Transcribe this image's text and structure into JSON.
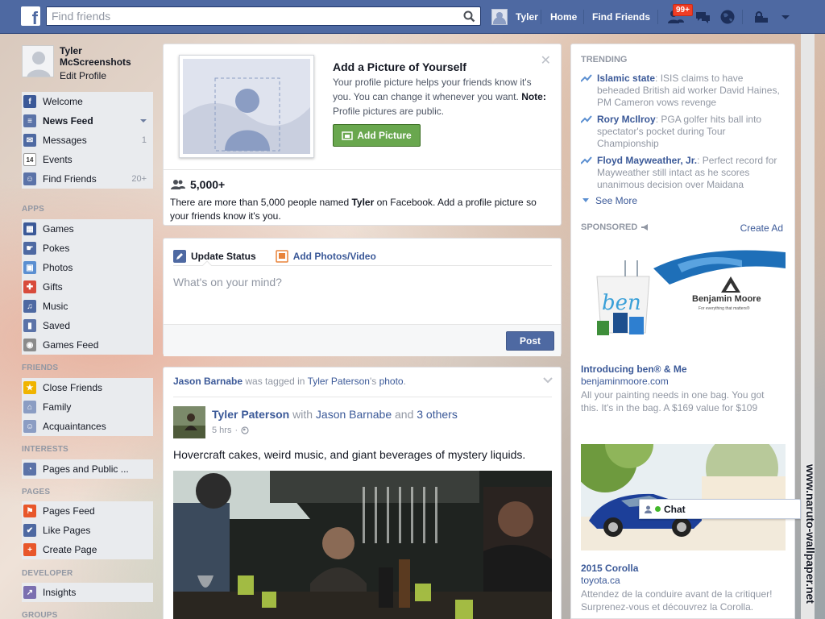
{
  "topbar": {
    "logo": "f",
    "search_placeholder": "Find friends",
    "user_name": "Tyler",
    "home": "Home",
    "find_friends": "Find Friends",
    "notif_badge": "99+"
  },
  "profile": {
    "name": "Tyler McScreenshots",
    "edit": "Edit Profile"
  },
  "nav": {
    "main": [
      {
        "label": "Welcome",
        "icon": "facebook-icon",
        "color": "#3b5998"
      },
      {
        "label": "News Feed",
        "icon": "news-feed-icon",
        "color": "#5b73a8"
      },
      {
        "label": "Messages",
        "icon": "messages-icon",
        "color": "#4e69a2",
        "count": "1"
      },
      {
        "label": "Events",
        "icon": "calendar-icon",
        "color": "#ffffff",
        "count_text": "14"
      },
      {
        "label": "Find Friends",
        "icon": "find-friends-icon",
        "color": "#5b73a8",
        "count": "20+"
      }
    ],
    "apps_head": "APPS",
    "apps": [
      {
        "label": "Games",
        "icon": "games-icon",
        "color": "#3b5998"
      },
      {
        "label": "Pokes",
        "icon": "pokes-icon",
        "color": "#4e69a2"
      },
      {
        "label": "Photos",
        "icon": "photos-icon",
        "color": "#5b8fd1"
      },
      {
        "label": "Gifts",
        "icon": "gift-icon",
        "color": "#d84b3c"
      },
      {
        "label": "Music",
        "icon": "music-icon",
        "color": "#4e69a2"
      },
      {
        "label": "Saved",
        "icon": "saved-icon",
        "color": "#5b73a8"
      },
      {
        "label": "Games Feed",
        "icon": "controller-icon",
        "color": "#8b8b8b"
      }
    ],
    "friends_head": "FRIENDS",
    "friends": [
      {
        "label": "Close Friends",
        "icon": "star-icon",
        "color": "#f0b400"
      },
      {
        "label": "Family",
        "icon": "family-icon",
        "color": "#8b9dc3"
      },
      {
        "label": "Acquaintances",
        "icon": "acquaintances-icon",
        "color": "#8b9dc3"
      }
    ],
    "interests_head": "INTERESTS",
    "interests": [
      {
        "label": "Pages and Public ...",
        "icon": "rss-icon",
        "color": "#5b73a8"
      }
    ],
    "pages_head": "PAGES",
    "pages": [
      {
        "label": "Pages Feed",
        "icon": "pages-feed-icon",
        "color": "#e8572b"
      },
      {
        "label": "Like Pages",
        "icon": "like-icon",
        "color": "#4e69a2"
      },
      {
        "label": "Create Page",
        "icon": "plus-icon",
        "color": "#e8572b"
      }
    ],
    "developer_head": "DEVELOPER",
    "developer": [
      {
        "label": "Insights",
        "icon": "insights-icon",
        "color": "#7b6fb0"
      }
    ],
    "groups_head": "GROUPS"
  },
  "addpic": {
    "title": "Add a Picture of Yourself",
    "text": "Your profile picture helps your friends know it's you. You can change it whenever you want.",
    "note_label": "Note:",
    "note_text": "Profile pictures are public.",
    "button": "Add Picture",
    "count": "5,000+",
    "foot_pre": "There are more than 5,000 people named ",
    "foot_name": "Tyler",
    "foot_post": " on Facebook. Add a profile picture so your friends know it's you."
  },
  "composer": {
    "tab_status": "Update Status",
    "tab_photos": "Add Photos/Video",
    "placeholder": "What's on your mind?",
    "post": "Post"
  },
  "story": {
    "actor": "Jason Barnabe",
    "verb": " was tagged in ",
    "owner": "Tyler Paterson",
    "possessive": "'s ",
    "object": "photo",
    "period": ".",
    "author": "Tyler Paterson",
    "with": " with ",
    "with_name": "Jason Barnabe",
    "and": " and ",
    "others": "3 others",
    "time": "5 hrs",
    "text": "Hovercraft cakes, weird music, and giant beverages of mystery liquids."
  },
  "right": {
    "trending_head": "TRENDING",
    "trends": [
      {
        "topic": "Islamic state",
        "text": ": ISIS claims to have beheaded British aid worker David Haines, PM Cameron vows revenge"
      },
      {
        "topic": "Rory McIlroy",
        "text": ": PGA golfer hits ball into spectator's pocket during Tour Championship"
      },
      {
        "topic": "Floyd Mayweather, Jr.",
        "text": ": Perfect record for Mayweather still intact as he scores unanimous decision over Maidana"
      }
    ],
    "see_more": "See More",
    "sponsored_head": "SPONSORED",
    "create_ad": "Create Ad",
    "ad1": {
      "brand": "Benjamin Moore",
      "tagline": "For everything that matters®",
      "ben": "ben",
      "title": "Introducing ben® & Me",
      "url": "benjaminmoore.com",
      "desc": "All your painting needs in one bag. You got this. It's in the bag. A $169 value for $109"
    },
    "ad2": {
      "title": "2015 Corolla",
      "url": "toyota.ca",
      "desc": "Attendez de la conduire avant de la critiquer! Surprenez-vous et découvrez la Corolla."
    }
  },
  "chat": {
    "label": "Chat"
  },
  "watermark": "www.naruto-wallpaper.net"
}
